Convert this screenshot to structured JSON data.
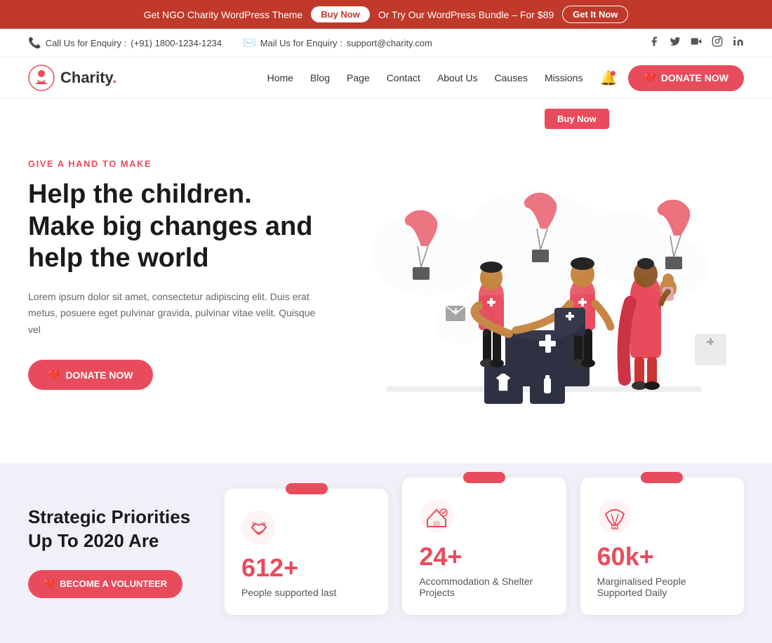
{
  "topBanner": {
    "text": "Get NGO Charity WordPress Theme",
    "buyNow": "Buy Now",
    "separator": "Or Try Our WordPress Bundle – For $89",
    "getItNow": "Get It Now"
  },
  "contactBar": {
    "callLabel": "Call Us for Enquiry :",
    "callNumber": "(+91) 1800-1234-1234",
    "mailLabel": "Mail Us for Enquiry :",
    "mailAddress": "support@charity.com",
    "socialLinks": [
      "f",
      "t",
      "▶",
      "ig",
      "in"
    ]
  },
  "navbar": {
    "logoText": "Charity",
    "logoDot": ".",
    "navItems": [
      {
        "label": "Home",
        "href": "#"
      },
      {
        "label": "Blog",
        "href": "#"
      },
      {
        "label": "Page",
        "href": "#"
      },
      {
        "label": "Contact",
        "href": "#"
      },
      {
        "label": "About Us",
        "href": "#"
      },
      {
        "label": "Causes",
        "href": "#"
      },
      {
        "label": "Missions",
        "href": "#"
      }
    ],
    "donateBtn": "DONATE NOW",
    "buyNowDropdown": "Buy Now"
  },
  "hero": {
    "eyebrow": "GIVE A HAND TO MAKE",
    "title": "Help the children. Make big changes and help the world",
    "description": "Lorem ipsum dolor sit amet, consectetur adipiscing elit. Duis erat metus, posuere eget pulvinar gravida, pulvinar vitae velit. Quisque vel",
    "donateBtn": "DONATE NOW"
  },
  "stats": {
    "sectionTitle": "Strategic Priorities Up To 2020 Are",
    "volunteerBtn": "BECOME A VOLUNTEER",
    "cards": [
      {
        "number": "612+",
        "label": "People supported last",
        "iconUnicode": "🤝"
      },
      {
        "number": "24+",
        "label": "Accommodation & Shelter Projects",
        "iconUnicode": "🏠"
      },
      {
        "number": "60k+",
        "label": "Marginalised People Supported Daily",
        "iconUnicode": "🪂"
      }
    ]
  }
}
